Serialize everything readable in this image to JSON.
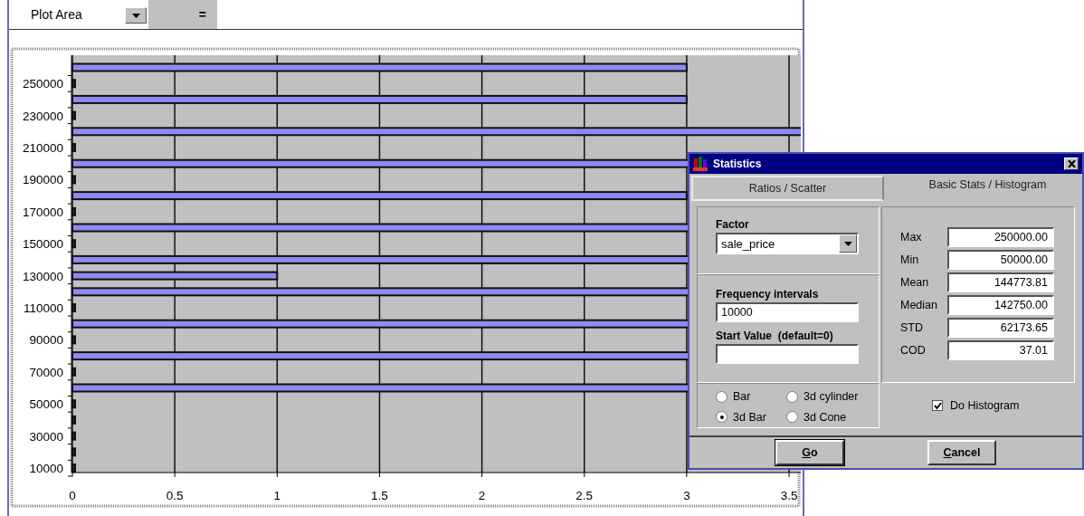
{
  "toolbar": {
    "name_box": "Plot Area",
    "equals": "="
  },
  "chart": {
    "y_labels": [
      "250000",
      "230000",
      "210000",
      "190000",
      "170000",
      "150000",
      "130000",
      "110000",
      "90000",
      "70000",
      "50000",
      "30000",
      "10000"
    ],
    "x_labels": [
      "0",
      "0.5",
      "1",
      "1.5",
      "2",
      "2.5",
      "3",
      "3.5"
    ]
  },
  "dialog": {
    "title": "Statistics",
    "tabs": [
      {
        "label": "Ratios / Scatter",
        "selected": false
      },
      {
        "label": "Basic Stats / Histogram",
        "selected": true
      }
    ],
    "factor": {
      "label": "Factor",
      "value": "sale_price"
    },
    "frequency": {
      "label": "Frequency intervals",
      "value": "10000"
    },
    "start": {
      "label": "Start Value  (default=0)"
    },
    "chart_types": [
      {
        "label": "Bar",
        "selected": false
      },
      {
        "label": "3d cylinder",
        "selected": false
      },
      {
        "label": "3d Bar",
        "selected": true
      },
      {
        "label": "3d Cone",
        "selected": false
      }
    ],
    "stats": [
      {
        "label": "Max",
        "value": "250000.00"
      },
      {
        "label": "Min",
        "value": "50000.00"
      },
      {
        "label": "Mean",
        "value": "144773.81"
      },
      {
        "label": "Median",
        "value": "142750.00"
      },
      {
        "label": "STD",
        "value": "62173.65"
      },
      {
        "label": "COD",
        "value": "37.01"
      }
    ],
    "do_histogram": {
      "label": "Do Histogram",
      "checked": true
    },
    "buttons": [
      "Go",
      "Cancel"
    ]
  }
}
